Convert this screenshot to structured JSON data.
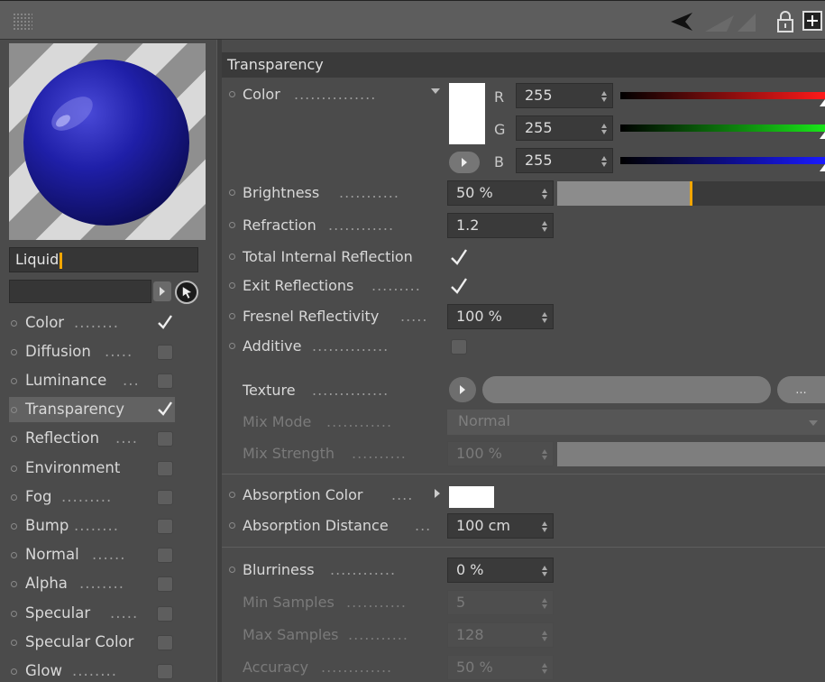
{
  "material": {
    "name": "Liquid"
  },
  "channels": [
    {
      "label": "Color",
      "checked": true
    },
    {
      "label": "Diffusion",
      "checked": false
    },
    {
      "label": "Luminance",
      "checked": false
    },
    {
      "label": "Transparency",
      "checked": true,
      "selected": true
    },
    {
      "label": "Reflection",
      "checked": false
    },
    {
      "label": "Environment",
      "checked": false
    },
    {
      "label": "Fog",
      "checked": false
    },
    {
      "label": "Bump",
      "checked": false
    },
    {
      "label": "Normal",
      "checked": false
    },
    {
      "label": "Alpha",
      "checked": false
    },
    {
      "label": "Specular",
      "checked": false
    },
    {
      "label": "Specular Color",
      "checked": false
    },
    {
      "label": "Glow",
      "checked": false
    }
  ],
  "section": {
    "title": "Transparency"
  },
  "color": {
    "label": "Color",
    "r_label": "R",
    "g_label": "G",
    "b_label": "B",
    "r": "255",
    "g": "255",
    "b": "255",
    "swatch_hex": "#ffffff"
  },
  "brightness": {
    "label": "Brightness",
    "value": "50 %",
    "fraction": 0.5
  },
  "refraction": {
    "label": "Refraction",
    "value": "1.2"
  },
  "total_internal_reflection": {
    "label": "Total Internal Reflection",
    "checked": true
  },
  "exit_reflections": {
    "label": "Exit Reflections",
    "checked": true
  },
  "fresnel": {
    "label": "Fresnel Reflectivity",
    "value": "100 %"
  },
  "additive": {
    "label": "Additive",
    "checked": false
  },
  "texture": {
    "label": "Texture",
    "more_label": "..."
  },
  "mix_mode": {
    "label": "Mix Mode",
    "value": "Normal"
  },
  "mix_strength": {
    "label": "Mix Strength",
    "value": "100 %",
    "fraction": 1.0
  },
  "absorption_color": {
    "label": "Absorption Color",
    "swatch_hex": "#ffffff"
  },
  "absorption_distance": {
    "label": "Absorption Distance",
    "value": "100 cm"
  },
  "blurriness": {
    "label": "Blurriness",
    "value": "0 %"
  },
  "min_samples": {
    "label": "Min Samples",
    "value": "5"
  },
  "max_samples": {
    "label": "Max Samples",
    "value": "128"
  },
  "accuracy": {
    "label": "Accuracy",
    "value": "50 %"
  },
  "colors": {
    "accent": "#f2a600",
    "panel": "#4b4b4b",
    "field": "#3a3a3a",
    "sphere": "#1e1e9c"
  }
}
